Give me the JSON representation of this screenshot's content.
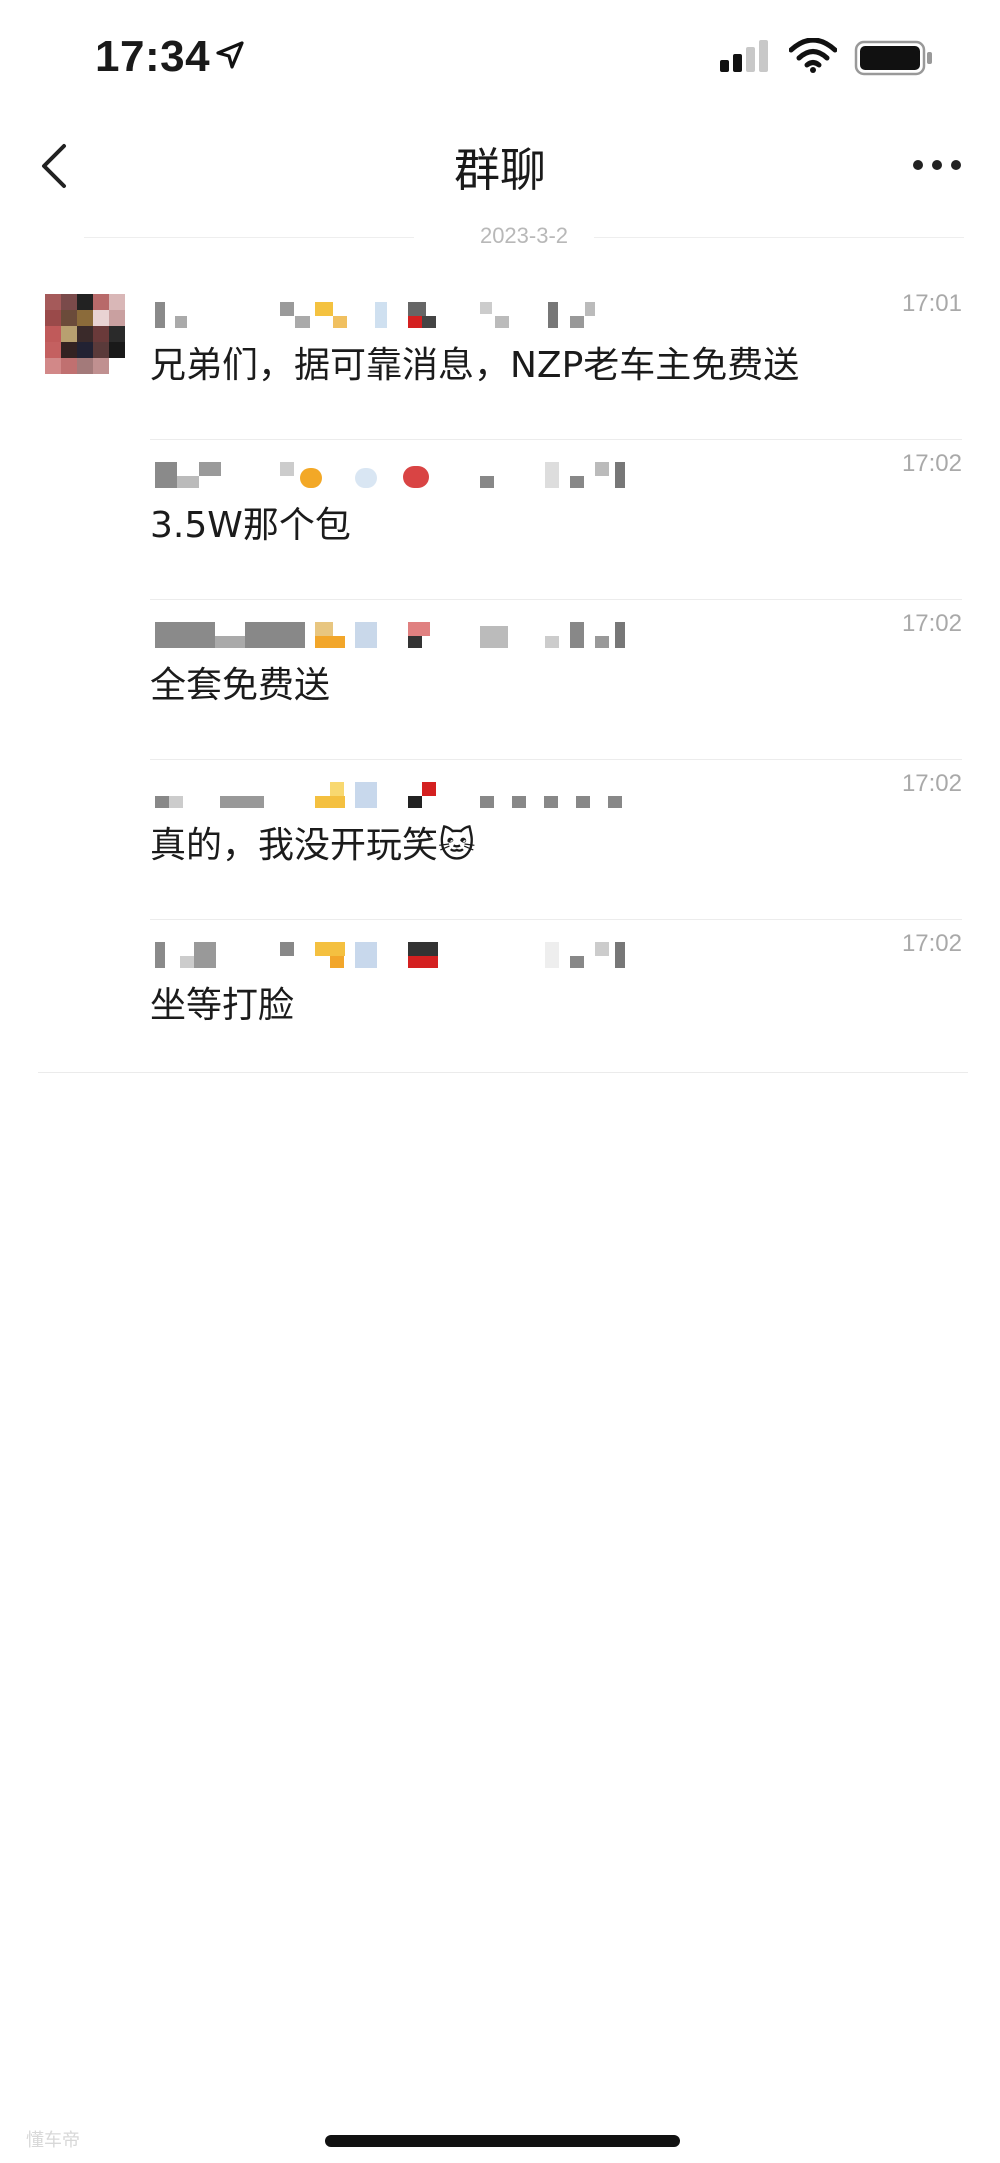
{
  "status_bar": {
    "time": "17:34"
  },
  "nav": {
    "title": "群聊"
  },
  "date_separator": "2023-3-2",
  "messages": [
    {
      "time": "17:01",
      "text": "兄弟们，据可靠消息，NZP老车主免费送"
    },
    {
      "time": "17:02",
      "text": "3.5W那个包"
    },
    {
      "time": "17:02",
      "text": "全套免费送"
    },
    {
      "time": "17:02",
      "text": "真的，我没开玩笑🐱"
    },
    {
      "time": "17:02",
      "text": "坐等打脸"
    }
  ],
  "watermark": {
    "brand": "懂车帝"
  }
}
